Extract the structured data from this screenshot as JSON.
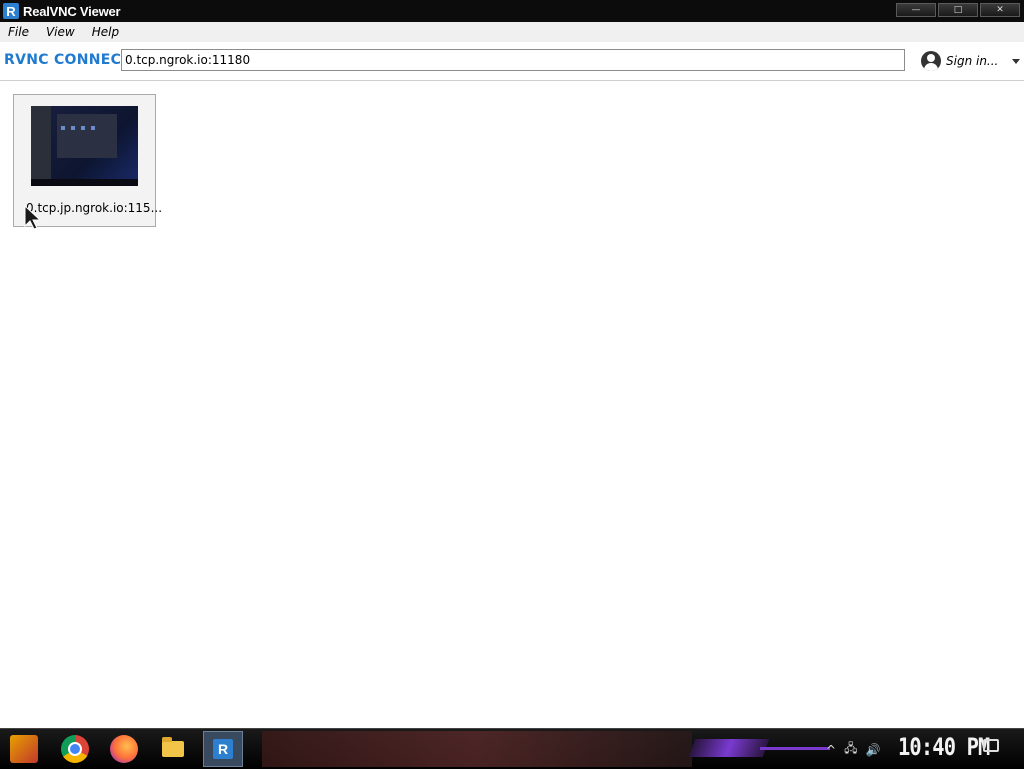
{
  "window": {
    "title": "RealVNC Viewer",
    "app_icon_letter": "R",
    "minimize_glyph": "—",
    "maximize_glyph": "□",
    "close_glyph": "✕"
  },
  "menu": {
    "items": [
      "File",
      "View",
      "Help"
    ]
  },
  "toolbar": {
    "logo_text": "RVNC CONNECT",
    "address_value": "0.tcp.ngrok.io:11180",
    "signin_label": "Sign in...",
    "accent_color": "#1f7ad0"
  },
  "connections": [
    {
      "label": "0.tcp.jp.ngrok.io:115..."
    }
  ],
  "taskbar": {
    "icons": [
      "start-icon",
      "chrome-icon",
      "firefox-icon",
      "file-explorer-icon",
      "realvnc-icon"
    ],
    "vnc_letter": "R",
    "tray_up": "^",
    "tray_network": "🖧",
    "tray_volume": "🔊",
    "clock": "10:40 PM"
  }
}
